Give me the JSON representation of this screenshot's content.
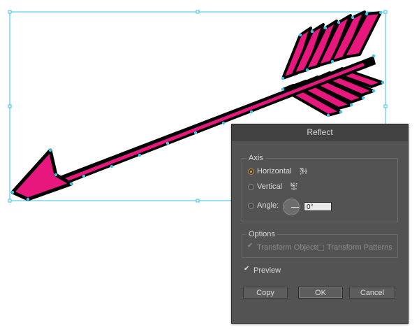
{
  "dialog": {
    "title": "Reflect",
    "axis": {
      "label": "Axis",
      "horizontal_label": "Horizontal",
      "vertical_label": "Vertical",
      "selected": "Horizontal",
      "angle_label": "Angle:",
      "angle_value": "0°"
    },
    "options": {
      "label": "Options",
      "transform_objects_label": "Transform Objects",
      "transform_objects_checked": true,
      "transform_patterns_label": "Transform Patterns",
      "transform_patterns_checked": false
    },
    "preview_label": "Preview",
    "preview_checked": true,
    "buttons": {
      "copy": "Copy",
      "ok": "OK",
      "cancel": "Cancel"
    }
  },
  "colors": {
    "arrow_fill": "#e8177e",
    "outline": "#000000",
    "selection": "#39c4e8",
    "dialog_bg": "#535353"
  }
}
